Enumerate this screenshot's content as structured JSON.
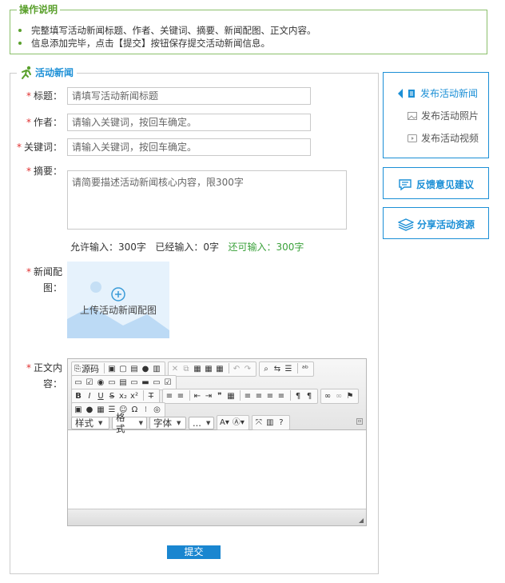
{
  "instructions": {
    "title": "操作说明",
    "items": [
      "完整填写活动新闻标题、作者、关键词、摘要、新闻配图、正文内容。",
      "信息添加完毕，点击【提交】按钮保存提交活动新闻信息。"
    ]
  },
  "form": {
    "title": "活动新闻",
    "required_mark": "*",
    "fields": {
      "title": {
        "label": "标题：",
        "placeholder": "请填写活动新闻标题"
      },
      "author": {
        "label": "作者：",
        "placeholder": "请输入关键词，按回车确定。"
      },
      "keywords": {
        "label": "关键词：",
        "placeholder": "请输入关键词，按回车确定。"
      },
      "summary": {
        "label": "摘要：",
        "placeholder": "请简要描述活动新闻核心内容，限300字"
      }
    },
    "counter": {
      "allowed": "允许输入：300字",
      "entered": "已经输入：0字",
      "remaining": "还可输入：300字"
    },
    "image": {
      "label_line1": "新闻配",
      "label_line2": "图：",
      "upload_text": "上传活动新闻配图"
    },
    "content": {
      "label_line1": "正文内",
      "label_line2": "容："
    },
    "submit_label": "提交"
  },
  "editor": {
    "source_label": "源码",
    "combos": [
      "样式",
      "格式",
      "字体",
      "..."
    ]
  },
  "sidebar": {
    "publish": [
      {
        "label": "发布活动新闻",
        "icon": "document-icon",
        "active": true
      },
      {
        "label": "发布活动照片",
        "icon": "photo-icon",
        "active": false
      },
      {
        "label": "发布活动视频",
        "icon": "video-icon",
        "active": false
      }
    ],
    "feedback": {
      "label": "反馈意见建议",
      "icon": "chat-icon"
    },
    "share": {
      "label": "分享活动资源",
      "icon": "layers-icon"
    }
  },
  "colors": {
    "accent_blue": "#1b8fd6",
    "accent_green": "#5aa02c",
    "required_red": "#e03030"
  }
}
